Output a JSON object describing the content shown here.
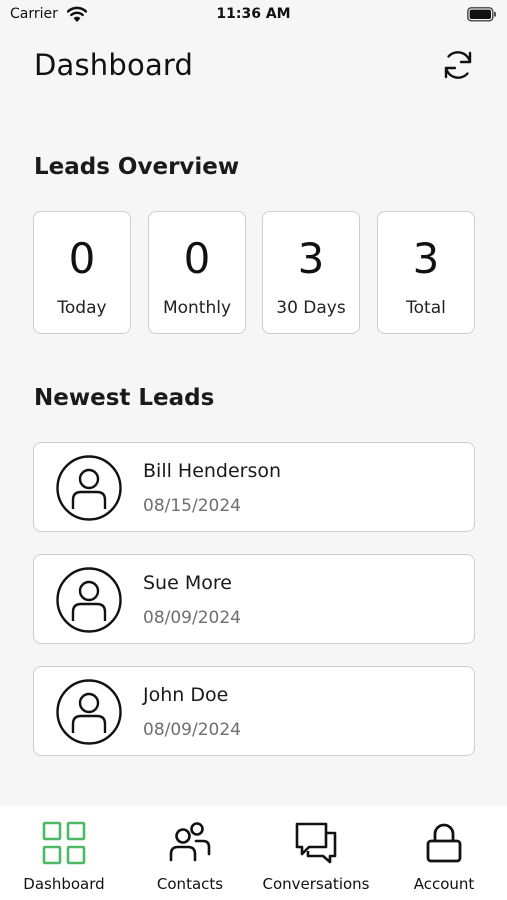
{
  "status_bar": {
    "carrier": "Carrier",
    "time": "11:36 AM"
  },
  "header": {
    "title": "Dashboard",
    "refresh_icon": "refresh-icon"
  },
  "overview": {
    "title": "Leads Overview",
    "stats": [
      {
        "value": "0",
        "label": "Today"
      },
      {
        "value": "0",
        "label": "Monthly"
      },
      {
        "value": "3",
        "label": "30 Days"
      },
      {
        "value": "3",
        "label": "Total"
      }
    ]
  },
  "newest_leads": {
    "title": "Newest Leads",
    "items": [
      {
        "name": "Bill Henderson",
        "date": "08/15/2024",
        "icon": "user-avatar-icon"
      },
      {
        "name": "Sue More",
        "date": "08/09/2024",
        "icon": "user-avatar-icon"
      },
      {
        "name": "John Doe",
        "date": "08/09/2024",
        "icon": "user-avatar-icon"
      }
    ]
  },
  "tab_bar": {
    "tabs": [
      {
        "label": "Dashboard",
        "icon": "grid-icon",
        "active": true
      },
      {
        "label": "Contacts",
        "icon": "people-icon",
        "active": false
      },
      {
        "label": "Conversations",
        "icon": "chat-bubbles-icon",
        "active": false
      },
      {
        "label": "Account",
        "icon": "lock-icon",
        "active": false
      }
    ]
  },
  "colors": {
    "accent": "#4cb963",
    "background": "#f6f6f6",
    "card": "#ffffff",
    "border": "#cfcfcf",
    "muted_text": "#6f6f6f"
  }
}
